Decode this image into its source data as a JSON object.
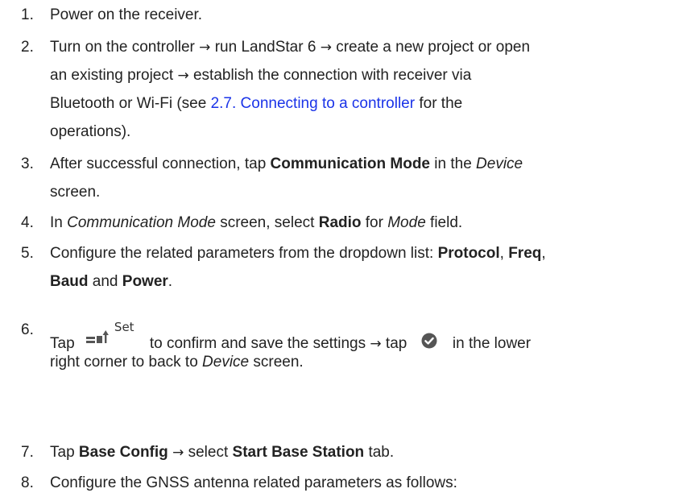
{
  "steps": [
    {
      "number": "1.",
      "parts": [
        "Power on the receiver."
      ]
    },
    {
      "number": "2.",
      "line1": "Turn on the controller",
      "arrow": "→",
      "line1b": "run LandStar 6",
      "line1c": "create a new project or open",
      "line2a": "an existing project",
      "line2b": "establish the connection with receiver via",
      "line3a": "Bluetooth or Wi-Fi (see ",
      "link": "2.7. Connecting to a controller",
      "line3b": " for the",
      "line4": "operations)."
    },
    {
      "number": "3.",
      "a": "After successful connection, tap ",
      "b": "Communication Mode",
      "c": " in the ",
      "d": "Device",
      "e": "screen."
    },
    {
      "number": "4.",
      "a": "In ",
      "b": "Communication Mode",
      "c": " screen, select ",
      "d": "Radio",
      "e": " for ",
      "f": "Mode",
      "g": " field."
    },
    {
      "number": "5.",
      "a": "Configure the related parameters from the dropdown list: ",
      "b": "Protocol",
      "c": ", ",
      "d": "Freq",
      "e": ",",
      "f": "Baud",
      "g": " and ",
      "h": "Power",
      "i": "."
    },
    {
      "number": "6.",
      "a": "Tap",
      "set_label": "Set",
      "b": "to confirm and save the settings",
      "c": "tap",
      "d": "in the lower",
      "e": "right corner to back to ",
      "f": "Device",
      "g": " screen.",
      "icons": [
        "set-icon",
        "check-circle-icon"
      ]
    },
    {
      "number": "7.",
      "a": "Tap ",
      "b": "Base Config",
      "c": "select ",
      "d": "Start Base Station",
      "e": " tab."
    },
    {
      "number": "8.",
      "a": "Configure the GNSS antenna related parameters as follows:"
    }
  ]
}
